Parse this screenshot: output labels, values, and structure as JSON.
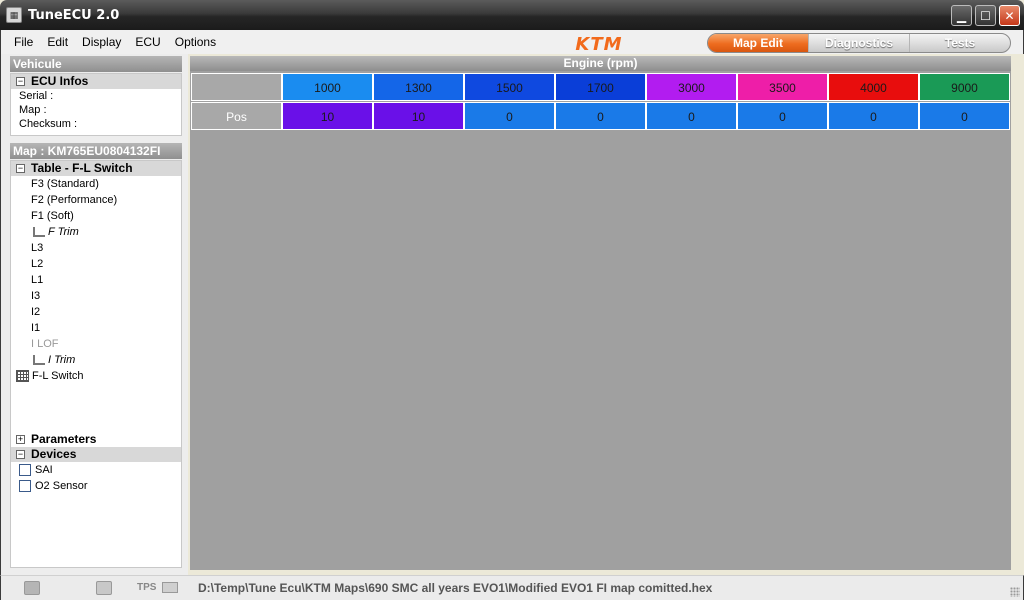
{
  "window": {
    "title": "TuneECU 2.0"
  },
  "menu": [
    "File",
    "Edit",
    "Display",
    "ECU",
    "Options"
  ],
  "brand": {
    "logo_text": "KTM",
    "color": "#f26a1b"
  },
  "mode_tabs": [
    {
      "label": "Map Edit",
      "active": true
    },
    {
      "label": "Diagnostics",
      "active": false
    },
    {
      "label": "Tests",
      "active": false
    }
  ],
  "vehicle": {
    "heading": "Vehicule",
    "ecu_infos": {
      "heading": "ECU Infos",
      "fields": [
        "Serial :",
        "Map :",
        "Checksum :"
      ]
    }
  },
  "map": {
    "heading": "Map : KM765EU0804132FI",
    "table_group": "Table - F-L Switch",
    "items": [
      "F3 (Standard)",
      "F2 (Performance)",
      "F1 (Soft)"
    ],
    "f_trim": "F Trim",
    "items2": [
      "L3",
      "L2",
      "L1",
      "I3",
      "I2",
      "I1"
    ],
    "ilof": "I LOF",
    "i_trim": "I Trim",
    "switch_item": "F-L Switch",
    "parameters": "Parameters",
    "devices_heading": "Devices",
    "devices": [
      "SAI",
      "O2 Sensor"
    ]
  },
  "table": {
    "axis_title": "Engine (rpm)",
    "columns": [
      "1000",
      "1300",
      "1500",
      "1700",
      "3000",
      "3500",
      "4000",
      "9000"
    ],
    "column_colors": [
      "#1a8cf0",
      "#1466e8",
      "#0f49e0",
      "#0a3ed8",
      "#b21cf0",
      "#ee1ea8",
      "#e80d0d",
      "#1a9a56"
    ],
    "row_label": "Pos",
    "values": [
      "10",
      "10",
      "0",
      "0",
      "0",
      "0",
      "0",
      "0"
    ],
    "value_colors": [
      "#6a10e8",
      "#6a10e8",
      "#1a7ae8",
      "#1a7ae8",
      "#1a7ae8",
      "#1a7ae8",
      "#1a7ae8",
      "#1a7ae8"
    ]
  },
  "status": {
    "tps_label": "TPS",
    "file_path": "D:\\Temp\\Tune Ecu\\KTM Maps\\690 SMC all years EVO1\\Modified EVO1 FI map comitted.hex"
  }
}
